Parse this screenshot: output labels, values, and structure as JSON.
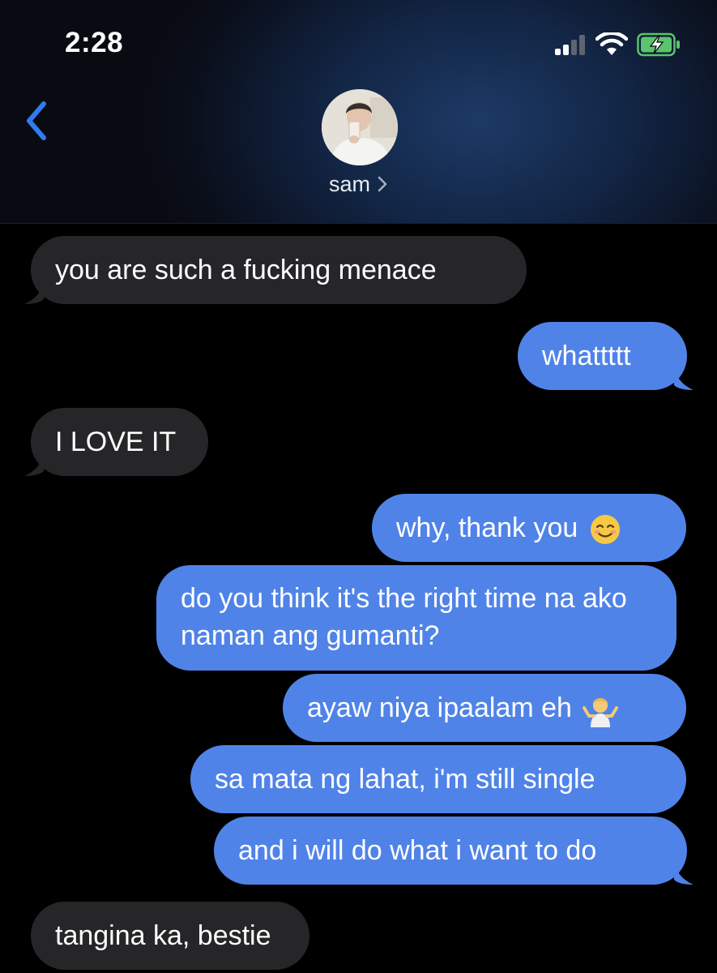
{
  "status_bar": {
    "time": "2:28",
    "icons": [
      "cellular-signal-icon",
      "wifi-icon",
      "battery-charging-icon"
    ]
  },
  "header": {
    "back_icon": "chevron-left-icon",
    "contact_name": "sam",
    "contact_chevron": "chevron-right-icon"
  },
  "colors": {
    "sent_bubble": "#5083e8",
    "received_bubble": "#262629",
    "accent": "#2f7bf2",
    "background": "#000000"
  },
  "messages": [
    {
      "direction": "received",
      "text": "you are such a fucking menace"
    },
    {
      "direction": "sent",
      "text": "whattttt"
    },
    {
      "direction": "received",
      "text": "I LOVE IT"
    },
    {
      "direction": "sent",
      "text": "why, thank you",
      "emoji": "smiling-face-icon"
    },
    {
      "direction": "sent",
      "text": "do you think it's the right time na ako naman ang gumanti?"
    },
    {
      "direction": "sent",
      "text": "ayaw niya ipaalam eh",
      "emoji": "person-shrugging-icon"
    },
    {
      "direction": "sent",
      "text": "sa mata ng lahat, i'm still single"
    },
    {
      "direction": "sent",
      "text": "and i will do what i want to do"
    },
    {
      "direction": "received",
      "text": "tangina ka, bestie"
    }
  ]
}
